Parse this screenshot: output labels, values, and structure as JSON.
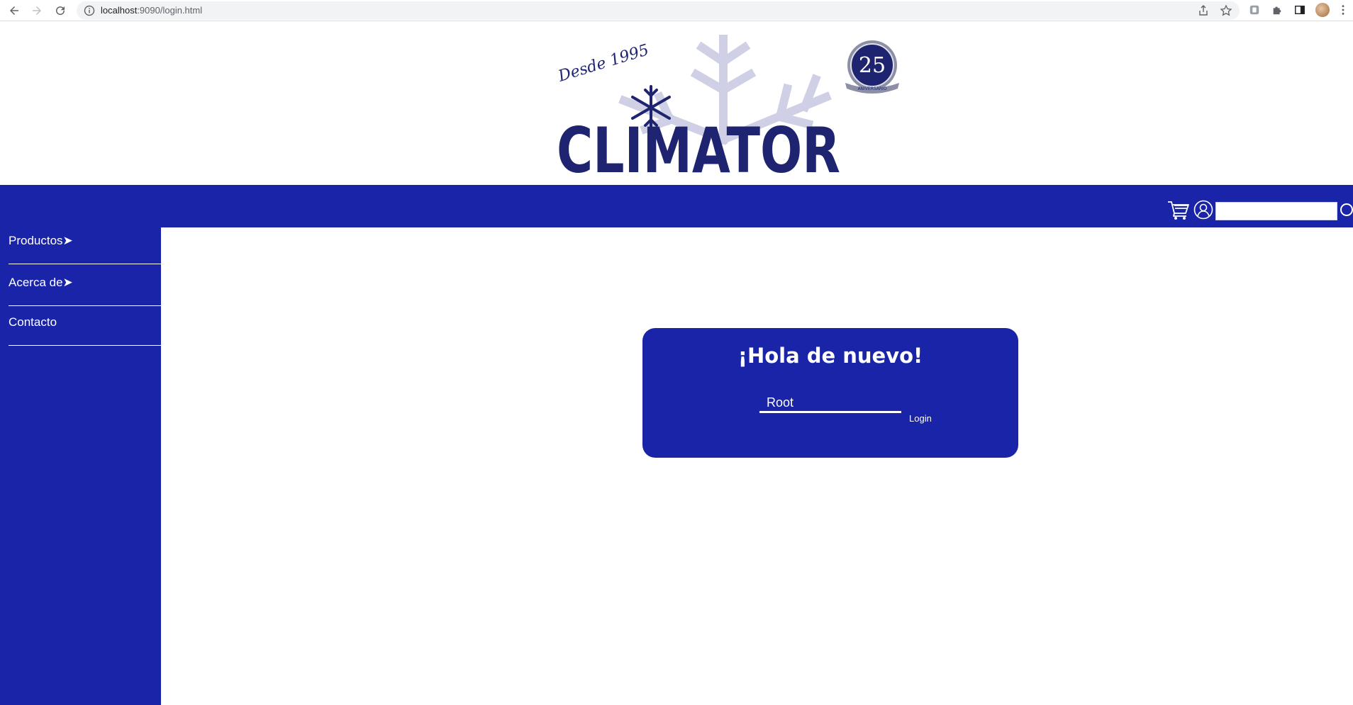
{
  "browser": {
    "url_host": "localhost",
    "url_port": ":9090",
    "url_path": "/login.html"
  },
  "header": {
    "logo_tagline": "Desde 1995",
    "logo_brand": "CLIMATOR",
    "anniversary_number": "25",
    "anniversary_text": "ANIVERSARIO"
  },
  "topbar": {
    "search_value": ""
  },
  "sidebar": {
    "items": [
      {
        "label": "Productos➤"
      },
      {
        "label": "Acerca de➤"
      },
      {
        "label": "Contacto"
      }
    ]
  },
  "login": {
    "title": "¡Hola de nuevo!",
    "username_value": "Root",
    "button_label": "Login"
  },
  "colors": {
    "brand_blue": "#1a24a8",
    "logo_navy": "#1e2470",
    "logo_lavender": "#cfd0e6"
  }
}
